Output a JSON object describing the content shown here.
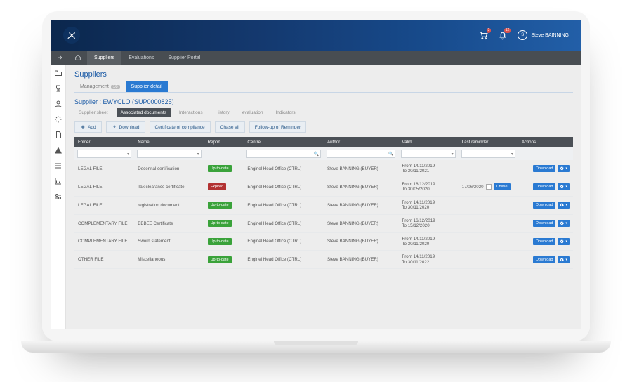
{
  "header": {
    "cart_count": "3",
    "bell_count": "12",
    "user_initial": "S",
    "user_name": "Steve BAINNING"
  },
  "nav": {
    "items": [
      "Suppliers",
      "Evaluations",
      "Supplier Portal"
    ],
    "active": 0
  },
  "page": {
    "title": "Suppliers",
    "tab_management": "Management",
    "tab_management_count": "16",
    "tab_detail": "Supplier detail",
    "sub_title": "Supplier : EWYCLO (SUP0000825)",
    "tabs2": [
      "Supplier sheet",
      "Associated documents",
      "Interactions",
      "History",
      "evaluation",
      "Indicators"
    ],
    "tabs2_active": 1
  },
  "toolbar": {
    "add": "Add",
    "download": "Download",
    "cert": "Certificate of compliance",
    "chase_all": "Chase all",
    "follow": "Follow-up of Reminder"
  },
  "columns": {
    "folder": "Folder",
    "name": "Name",
    "report": "Report",
    "centre": "Centre",
    "author": "Author",
    "valid": "Valid",
    "last": "Last reminder",
    "actions": "Actions"
  },
  "status": {
    "uptodate": "Up-to-date",
    "expired": "Expired"
  },
  "btn": {
    "download": "Download",
    "chase": "Chase"
  },
  "rows": [
    {
      "folder": "LEGAL FILE",
      "name": "Decennal certification",
      "status": "uptodate",
      "centre": "Enginel Head Office (CTRL)",
      "author": "Steve BANNING (BUYER)",
      "valid_from": "From 14/11/2019",
      "valid_to": "To 30/11/2021",
      "last": "",
      "chase": false
    },
    {
      "folder": "LEGAL FILE",
      "name": "Tax clearance certificate",
      "status": "expired",
      "centre": "Enginel Head Office (CTRL)",
      "author": "Steve BANNING (BUYER)",
      "valid_from": "From 16/12/2019",
      "valid_to": "To 30/05/2020",
      "last": "17/06/2020",
      "chase": true
    },
    {
      "folder": "LEGAL FILE",
      "name": "registration document",
      "status": "uptodate",
      "centre": "Enginel Head Office (CTRL)",
      "author": "Steve BANNING (BUYER)",
      "valid_from": "From 14/11/2019",
      "valid_to": "To 30/11/2020",
      "last": "",
      "chase": false
    },
    {
      "folder": "COMPLEMENTARY FILE",
      "name": "BBBEE Certificate",
      "status": "uptodate",
      "centre": "Enginel Head Office (CTRL)",
      "author": "Steve BANNING (BUYER)",
      "valid_from": "From 16/12/2019",
      "valid_to": "To 15/12/2020",
      "last": "",
      "chase": false
    },
    {
      "folder": "COMPLEMENTARY FILE",
      "name": "Sworn statement",
      "status": "uptodate",
      "centre": "Enginel Head Office (CTRL)",
      "author": "Steve BANNING (BUYER)",
      "valid_from": "From 14/11/2019",
      "valid_to": "To 30/11/2020",
      "last": "",
      "chase": false
    },
    {
      "folder": "OTHER FILE",
      "name": "Miscellaneous",
      "status": "uptodate",
      "centre": "Enginel Head Office (CTRL)",
      "author": "Steve BANNING (BUYER)",
      "valid_from": "From 14/11/2019",
      "valid_to": "To 30/11/2022",
      "last": "",
      "chase": false
    }
  ]
}
